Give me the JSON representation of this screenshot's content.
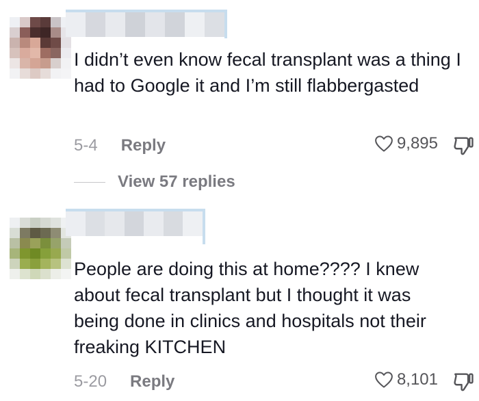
{
  "comments": [
    {
      "text": "I didn’t even know fecal transplant was a thing I had to Google it and I’m still flabbergasted",
      "date": "5-4",
      "reply_label": "Reply",
      "likes": "9,895",
      "view_replies": "View 57 replies"
    },
    {
      "text": "People are doing this at home???? I knew\nabout fecal transplant but I thought it was\nbeing done in clinics and hospitals not their\nfreaking KITCHEN",
      "date": "5-20",
      "reply_label": "Reply",
      "likes": "8,101"
    }
  ],
  "colors": {
    "text": "#161823",
    "meta": "#9b9ba1",
    "blur_frame": "#c7ddee"
  },
  "icons": [
    "heart-outline-icon",
    "dislike-thumb-icon"
  ]
}
